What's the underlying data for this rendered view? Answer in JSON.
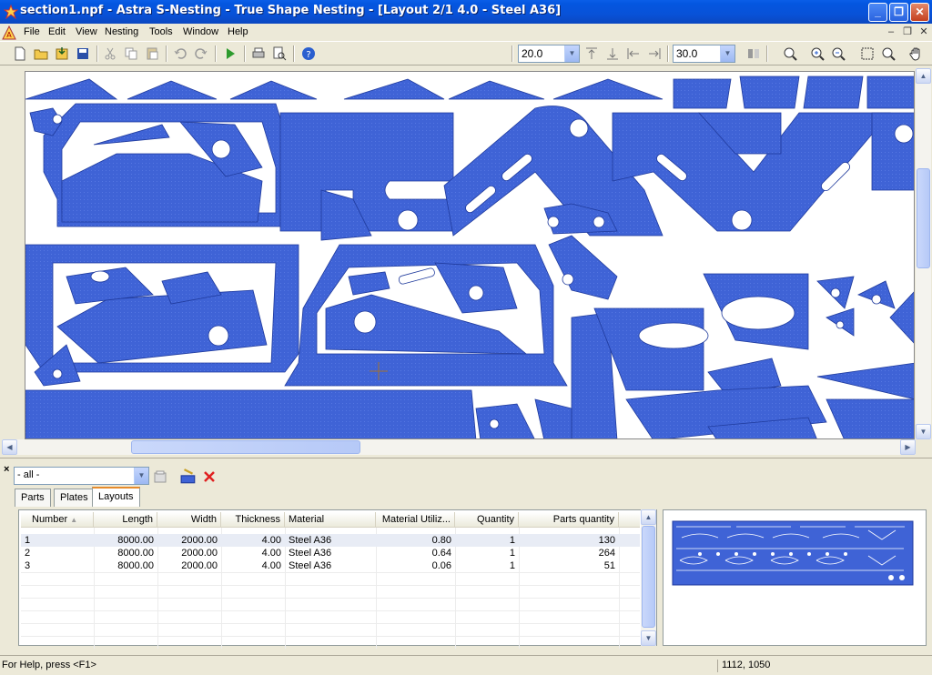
{
  "window": {
    "title": "section1.npf - Astra S-Nesting - True Shape Nesting - [Layout 2/1 4.0 - Steel A36]",
    "minimize_label": "_",
    "maximize_label": "❐",
    "close_label": "✕"
  },
  "menu": {
    "items": [
      "File",
      "Edit",
      "View",
      "Nesting",
      "Tools",
      "Window",
      "Help"
    ],
    "mdi_min": "–",
    "mdi_restore": "❐",
    "mdi_close": "✕"
  },
  "toolbar": {
    "zoom_value_1": "20.0",
    "zoom_value_2": "30.0"
  },
  "panel": {
    "close_label": "×",
    "filter_value": "- all -",
    "tabs": [
      "Parts",
      "Plates",
      "Layouts"
    ],
    "active_tab": "Layouts",
    "columns": [
      "Number",
      "Length",
      "Width",
      "Thickness",
      "Material",
      "Material Utiliz...",
      "Quantity",
      "Parts quantity"
    ],
    "rows": [
      [
        "1",
        "8000.00",
        "2000.00",
        "4.00",
        "Steel A36",
        "0.80",
        "1",
        "130"
      ],
      [
        "2",
        "8000.00",
        "2000.00",
        "4.00",
        "Steel A36",
        "0.64",
        "1",
        "264"
      ],
      [
        "3",
        "8000.00",
        "2000.00",
        "4.00",
        "Steel A36",
        "0.06",
        "1",
        "51"
      ]
    ]
  },
  "status": {
    "help_text": "For Help, press <F1>",
    "coords": "1112, 1050"
  },
  "colors": {
    "part_fill": "#3f63d6",
    "part_stroke": "#1f3a9c",
    "sheet_bg": "#ffffff",
    "title_blue": "#0a5ee8"
  }
}
